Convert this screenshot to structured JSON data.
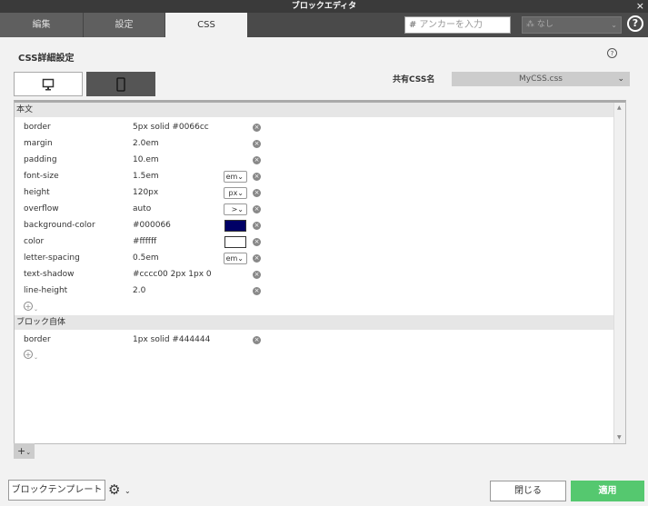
{
  "window": {
    "title": "ブロックエディタ",
    "close_glyph": "×"
  },
  "tabs": [
    {
      "label": "編集"
    },
    {
      "label": "設定"
    },
    {
      "label": "CSS"
    }
  ],
  "anchor": {
    "hash": "#",
    "placeholder": "アンカーを入力"
  },
  "nashi": {
    "label": "なし"
  },
  "header": {
    "title": "CSS詳細設定",
    "help_glyph": "?"
  },
  "shared_css": {
    "label": "共有CSS名",
    "value": "MyCSS.css"
  },
  "sections": [
    {
      "title": "本文",
      "rows": [
        {
          "prop": "border",
          "value": "5px solid #0066cc"
        },
        {
          "prop": "margin",
          "value": "2.0em"
        },
        {
          "prop": "padding",
          "value": "10.em"
        },
        {
          "prop": "font-size",
          "value": "1.5em",
          "unit": "em"
        },
        {
          "prop": "height",
          "value": "120px",
          "unit": "px"
        },
        {
          "prop": "overflow",
          "value": "auto",
          "unit": ">"
        },
        {
          "prop": "background-color",
          "value": "#000066",
          "swatch": "#000066"
        },
        {
          "prop": "color",
          "value": "#ffffff",
          "swatch": "#ffffff"
        },
        {
          "prop": "letter-spacing",
          "value": "0.5em",
          "unit": "em"
        },
        {
          "prop": "text-shadow",
          "value": "#cccc00 2px 1px 0"
        },
        {
          "prop": "line-height",
          "value": "2.0"
        }
      ]
    },
    {
      "title": "ブロック自体",
      "rows": [
        {
          "prop": "border",
          "value": "1px solid #444444"
        }
      ]
    }
  ],
  "footer": {
    "template_button": "ブロックテンプレート",
    "close_button": "閉じる",
    "apply_button": "適用"
  },
  "colors": {
    "apply": "#55c86f",
    "titlebar": "#3a3a3a",
    "tabbar": "#4a4a4a"
  }
}
